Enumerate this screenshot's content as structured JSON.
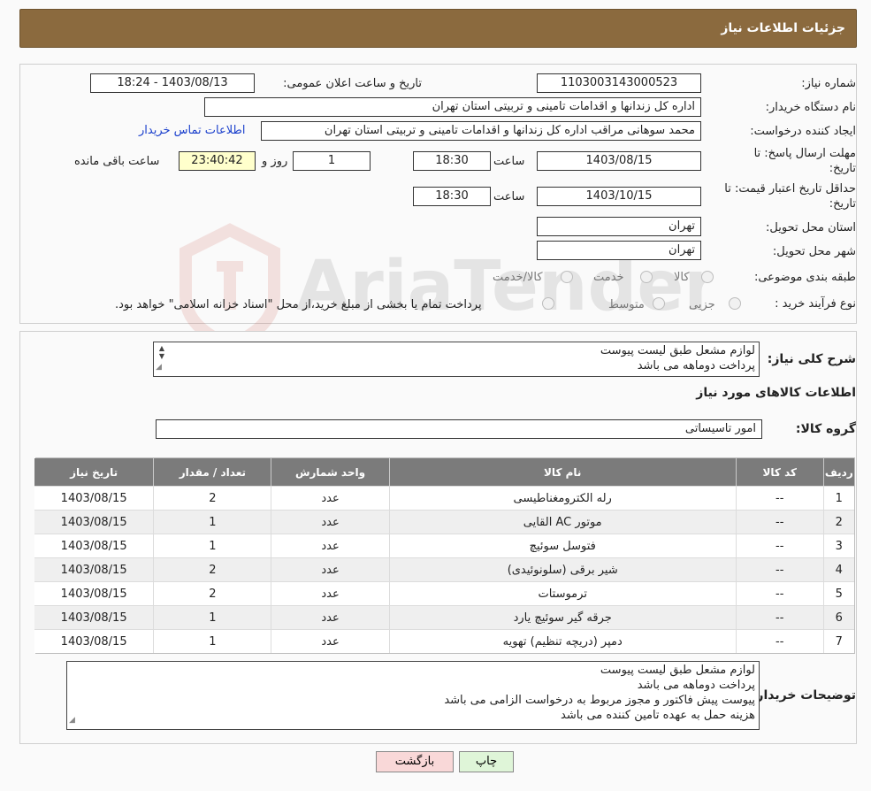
{
  "header": {
    "title": "جزئیات اطلاعات نیاز"
  },
  "watermark": {
    "text": "AriaTender.neT"
  },
  "fields": {
    "need_number_label": "شماره نیاز:",
    "need_number": "1103003143000523",
    "announce_label": "تاریخ و ساعت اعلان عمومی:",
    "announce_value": "1403/08/13 - 18:24",
    "buyer_org_label": "نام دستگاه خریدار:",
    "buyer_org": "اداره کل زندانها و اقدامات تامینی و تربیتی استان تهران",
    "requester_label": "ایجاد کننده درخواست:",
    "requester": "محمد سوهانی مراقب  اداره کل زندانها و اقدامات تامینی و تربیتی استان تهران",
    "contact_link": "اطلاعات تماس خریدار",
    "deadline_label_1": "مهلت ارسال پاسخ: تا",
    "deadline_label_2": "تاریخ:",
    "deadline_date": "1403/08/15",
    "time_label": "ساعت",
    "deadline_time": "18:30",
    "days_value": "1",
    "days_label": "روز و",
    "remaining_time": "23:40:42",
    "remaining_label": "ساعت باقی مانده",
    "validity_label_1": "حداقل تاریخ اعتبار قیمت: تا",
    "validity_label_2": "تاریخ:",
    "validity_date": "1403/10/15",
    "validity_time_label": "ساعت",
    "validity_time": "18:30",
    "province_label": "استان محل تحویل:",
    "province": "تهران",
    "city_label": "شهر محل تحویل:",
    "city": "تهران",
    "category_label": "طبقه بندی موضوعی:",
    "category_options": [
      "کالا",
      "خدمت",
      "کالا/خدمت"
    ],
    "process_label": "نوع فرآیند خرید :",
    "process_options": [
      "جزیی",
      "متوسط"
    ],
    "process_note": "پرداخت تمام یا بخشی از مبلغ خرید،از محل \"اسناد خزانه اسلامی\" خواهد بود."
  },
  "summary": {
    "label": "شرح کلی نیاز:",
    "lines": [
      "لوازم مشعل طبق لیست پیوست",
      "پرداخت دوماهه می باشد"
    ]
  },
  "goods": {
    "section_title": "اطلاعات کالاهای مورد نیاز",
    "group_label": "گروه کالا:",
    "group_value": "امور تاسیساتی",
    "columns": [
      "ردیف",
      "کد کالا",
      "نام کالا",
      "واحد شمارش",
      "تعداد / مقدار",
      "تاریخ نیاز"
    ],
    "rows": [
      [
        "1",
        "--",
        "رله الکترومغناطیسی",
        "عدد",
        "2",
        "1403/08/15"
      ],
      [
        "2",
        "--",
        "موتور AC القایی",
        "عدد",
        "1",
        "1403/08/15"
      ],
      [
        "3",
        "--",
        "فتوسل سوئیچ",
        "عدد",
        "1",
        "1403/08/15"
      ],
      [
        "4",
        "--",
        "شیر برقی (سلونوئیدی)",
        "عدد",
        "2",
        "1403/08/15"
      ],
      [
        "5",
        "--",
        "ترموستات",
        "عدد",
        "2",
        "1403/08/15"
      ],
      [
        "6",
        "--",
        "جرقه گیر سوئیچ یارد",
        "عدد",
        "1",
        "1403/08/15"
      ],
      [
        "7",
        "--",
        "دمپر (دریچه تنظیم) تهویه",
        "عدد",
        "1",
        "1403/08/15"
      ]
    ]
  },
  "buyer_notes": {
    "label": "توضیحات خریدار:",
    "lines": [
      "لوازم مشعل طبق لیست پیوست",
      "پرداخت دوماهه می باشد",
      "پیوست پیش فاکتور و مجوز مربوط به درخواست الزامی می باشد",
      "هزینه حمل به عهده تامین کننده می باشد"
    ]
  },
  "buttons": {
    "print": "چاپ",
    "back": "بازگشت"
  },
  "colors": {
    "header_bg": "#8b6a3e",
    "table_header_bg": "#7b7b7b",
    "link": "#1a3fcc"
  }
}
